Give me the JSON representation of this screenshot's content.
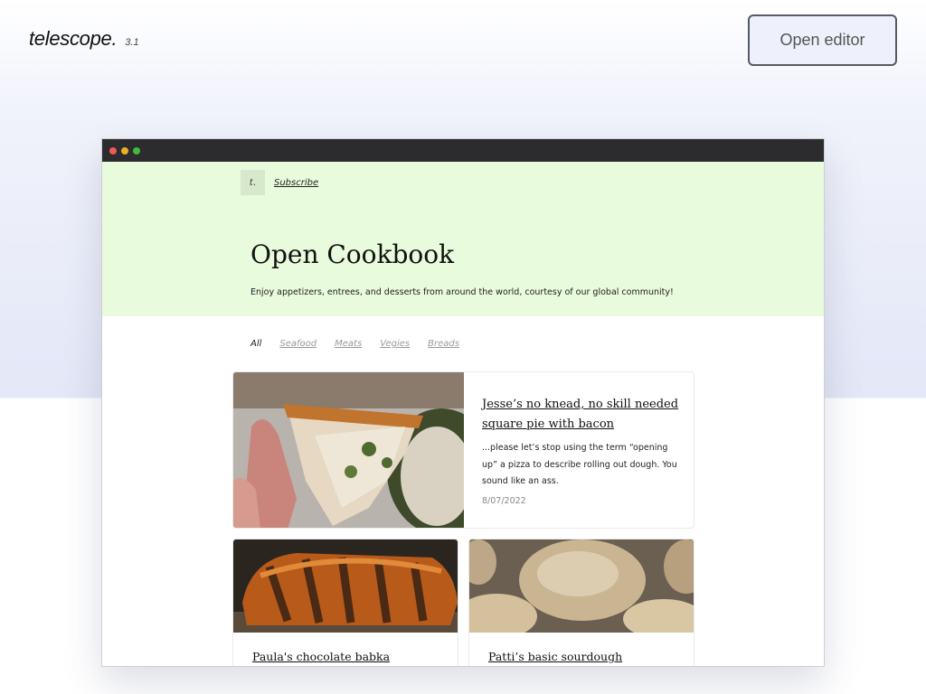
{
  "app": {
    "name": "telescope.",
    "version": "3.1",
    "open_editor_label": "Open editor"
  },
  "site": {
    "logo_text": "t.",
    "subscribe_label": "Subscribe",
    "title": "Open Cookbook",
    "description": "Enjoy appetizers, entrees, and desserts from around the world, courtesy of our global community!",
    "filters": [
      "All",
      "Seafood",
      "Meats",
      "Vegies",
      "Breads"
    ],
    "active_filter": "All",
    "hero_color": "#e8fbdc"
  },
  "posts": [
    {
      "title": "Jesse’s no knead, no skill needed square pie with bacon",
      "excerpt": "...please let’s stop using the term “opening up” a pizza to describe rolling out dough. You sound like an ass.",
      "date": "8/07/2022",
      "image": "pizza-slice-photo"
    },
    {
      "title": "Paula's chocolate babka",
      "image": "babka-photo"
    },
    {
      "title": "Patti’s basic sourdough",
      "image": "sourdough-photo"
    }
  ]
}
